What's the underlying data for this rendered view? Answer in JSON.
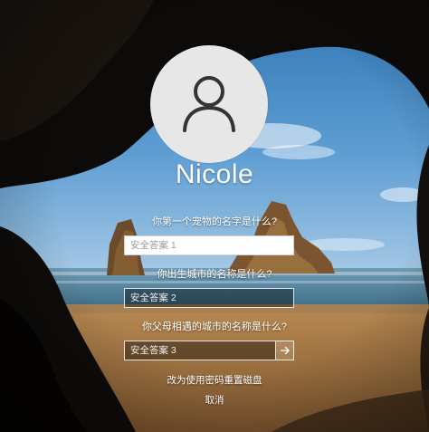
{
  "user": {
    "name": "Nicole"
  },
  "security_questions": [
    {
      "question": "你第一个宠物的名字是什么?",
      "placeholder": "安全答案 1"
    },
    {
      "question": "你出生城市的名称是什么?",
      "placeholder": "安全答案 2"
    },
    {
      "question": "你父母相遇的城市的名称是什么?",
      "placeholder": "安全答案 3"
    }
  ],
  "links": {
    "reset_disk": "改为使用密码重置磁盘",
    "cancel": "取消"
  },
  "icons": {
    "avatar": "user-icon",
    "submit": "arrow-right-icon"
  },
  "colors": {
    "avatar_bg": "#e7e7e7",
    "text": "#ffffff"
  }
}
